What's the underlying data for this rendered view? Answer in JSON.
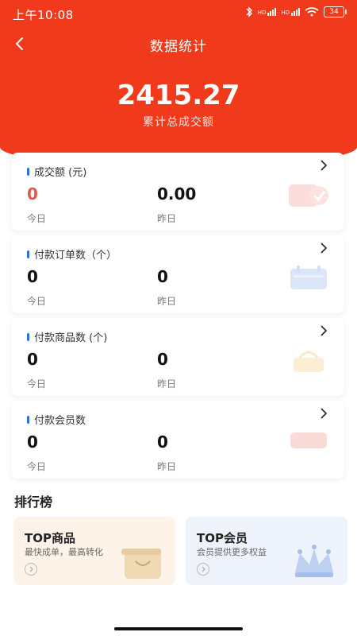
{
  "status_bar": {
    "time": "上午10:08",
    "signal_1": "HD",
    "signal_2": "HD",
    "battery": "34"
  },
  "nav": {
    "title": "数据统计"
  },
  "summary": {
    "total": "2415.27",
    "label": "累计总成交额"
  },
  "cards": [
    {
      "title": "成交额 (元)",
      "today_value": "0",
      "yesterday_value": "0.00",
      "today_label": "今日",
      "yesterday_label": "昨日",
      "icon": "money-chart-icon"
    },
    {
      "title": "付款订单数（个）",
      "today_value": "0",
      "yesterday_value": "0",
      "today_label": "今日",
      "yesterday_label": "昨日",
      "icon": "calendar-icon"
    },
    {
      "title": "付款商品数 (个)",
      "today_value": "0",
      "yesterday_value": "0",
      "today_label": "今日",
      "yesterday_label": "昨日",
      "icon": "basket-icon"
    },
    {
      "title": "付款会员数",
      "today_value": "0",
      "yesterday_value": "0",
      "today_label": "今日",
      "yesterday_label": "昨日",
      "icon": "member-card-icon"
    }
  ],
  "ranking": {
    "title": "排行榜",
    "goods": {
      "name": "TOP商品",
      "subtitle": "最快成单，最高转化",
      "icon": "shopping-bag-icon"
    },
    "members": {
      "name": "TOP会员",
      "subtitle": "会员提供更多权益",
      "icon": "crown-icon"
    }
  },
  "colors": {
    "primary": "#f13a1b",
    "accent_bar": "#2f6de1",
    "today_amount": "#e35a55"
  }
}
